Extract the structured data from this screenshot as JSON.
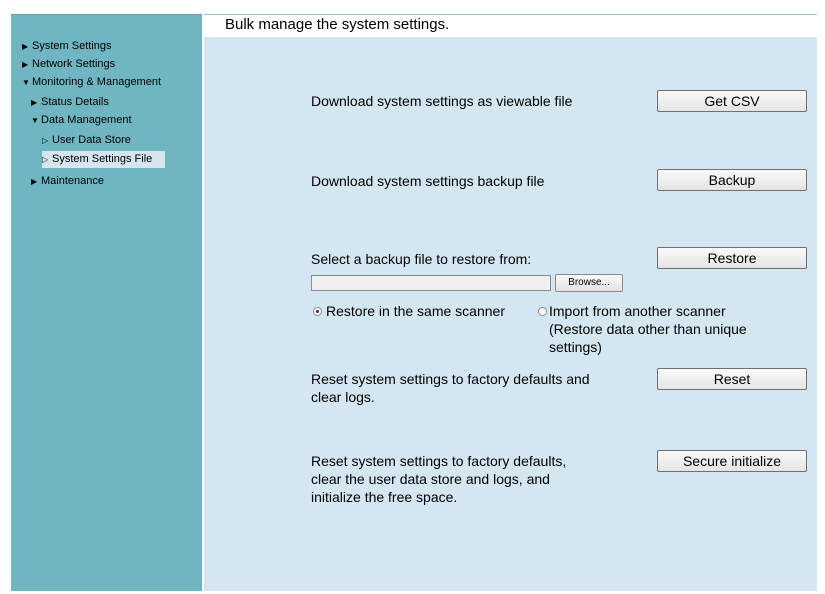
{
  "sidebar": {
    "items": [
      {
        "label": "System Settings",
        "arrow": "▶"
      },
      {
        "label": "Network Settings",
        "arrow": "▶"
      },
      {
        "label": "Monitoring & Management",
        "arrow": "▼"
      },
      {
        "label": "Status Details",
        "arrow": "▶"
      },
      {
        "label": "Data Management",
        "arrow": "▼"
      },
      {
        "label": "User Data Store",
        "arrow": "▷"
      },
      {
        "label": "System Settings File",
        "arrow": "▷"
      },
      {
        "label": "Maintenance",
        "arrow": "▶"
      }
    ],
    "selected": "System Settings File"
  },
  "main": {
    "title": "Bulk manage the system settings.",
    "csv": {
      "text": "Download system settings as viewable file",
      "button": "Get CSV"
    },
    "backup": {
      "text": "Download system settings backup file",
      "button": "Backup"
    },
    "restore": {
      "text": "Select a backup file to restore from:",
      "button": "Restore",
      "browse": "Browse...",
      "file_value": "",
      "options": [
        {
          "label": "Restore in the same scanner",
          "checked": true
        },
        {
          "label": "Import from another scanner",
          "checked": false
        }
      ],
      "option2_note_line1": "(Restore data other than unique",
      "option2_note_line2": "settings)"
    },
    "reset": {
      "line1": "Reset system settings to factory defaults and",
      "line2": "clear logs.",
      "button": "Reset"
    },
    "secure": {
      "line1": "Reset system settings to factory defaults,",
      "line2": "clear the user data store and logs, and",
      "line3": "initialize the free space.",
      "button": "Secure initialize"
    }
  },
  "colors": {
    "sidebar_bg": "#6fb6c2",
    "main_bg": "#d3e6f1",
    "selected_bg": "#d6e6ee"
  }
}
